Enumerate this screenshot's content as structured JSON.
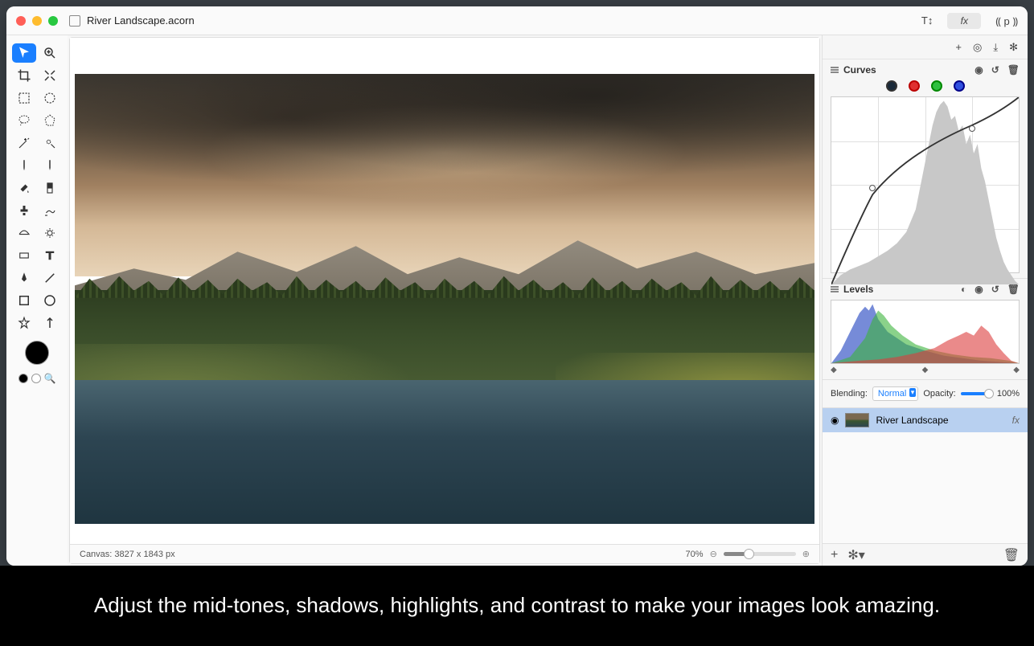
{
  "titlebar": {
    "filename": "River Landscape.acorn",
    "fx_label": "fx",
    "palette_label": "⸨ p ⸩",
    "text_tool_icon": "T↕"
  },
  "panel_icons": {
    "add": "+",
    "target": "◎",
    "download": "⤓",
    "gear": "✻"
  },
  "curves": {
    "title": "Curves",
    "channels": [
      {
        "name": "rgb",
        "border": "#333",
        "fill": "#1a2a3a"
      },
      {
        "name": "red",
        "border": "#b00",
        "fill": "#e03030"
      },
      {
        "name": "green",
        "border": "#080",
        "fill": "#30c040"
      },
      {
        "name": "blue",
        "border": "#008",
        "fill": "#3050e0"
      }
    ],
    "icons": {
      "eye": "◉",
      "reset": "↺",
      "trash": "🗑"
    }
  },
  "levels": {
    "title": "Levels",
    "icons": {
      "contrast": "◐",
      "eye": "◉",
      "reset": "↺",
      "trash": "🗑"
    }
  },
  "blending": {
    "label": "Blending:",
    "mode": "Normal",
    "opacity_label": "Opacity:",
    "opacity_value": "100%"
  },
  "layers": {
    "active_name": "River Landscape",
    "eye": "◉",
    "fx": "fx"
  },
  "statusbar": {
    "canvas_info": "Canvas: 3827 x 1843 px",
    "zoom": "70%"
  },
  "bottom_panel": {
    "add": "+",
    "gear": "✻▾",
    "trash": "🗑"
  },
  "caption": "Adjust the mid-tones, shadows, highlights, and contrast to make your images look amazing."
}
